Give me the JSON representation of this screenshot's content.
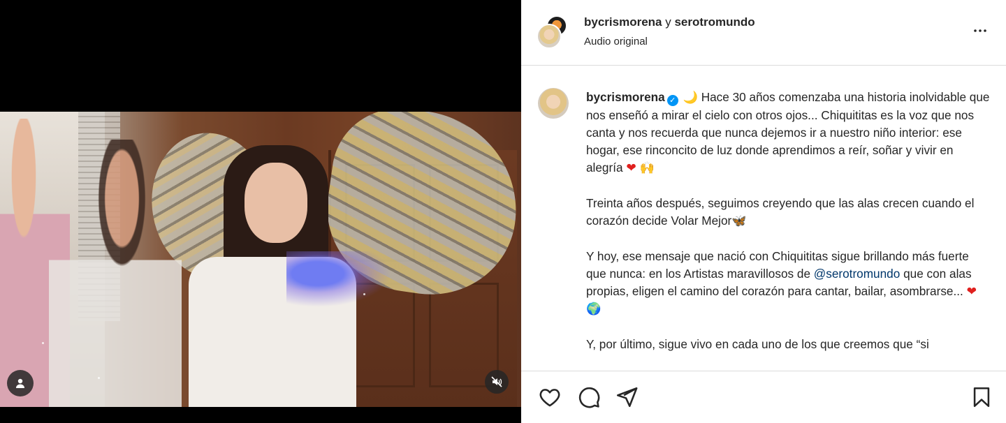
{
  "header": {
    "user1": "bycrismorena",
    "separator": "y",
    "user2": "serotromundo",
    "audio": "Audio original"
  },
  "caption": {
    "username": "bycrismorena",
    "moon_emoji": "🌙",
    "p1": "Hace 30 años comenzaba una historia inolvidable que nos enseñó a mirar el cielo con otros ojos... Chiquititas es la voz que nos canta y nos recuerda que nunca dejemos ir a nuestro niño interior: ese hogar, ese rinconcito de luz donde aprendimos a reír, soñar y vivir en alegría",
    "p1_emojis": "🙌",
    "heart": "❤",
    "p2": "Treinta años después, seguimos creyendo que las alas crecen cuando el corazón decide Volar Mejor",
    "butterfly_emoji": "🦋",
    "p3_a": "Y hoy, ese mensaje que nació con Chiquititas sigue brillando más fuerte que nunca: en los Artistas maravillosos de",
    "mention": "@serotromundo",
    "p3_b": "que con alas propias, eligen el camino del corazón para cantar, bailar, asombrarse...",
    "p3_emoji2": "🌍",
    "p4": "Y, por último, sigue vivo en cada uno de los que creemos que “si"
  },
  "icons": {
    "like": "heart-outline-icon",
    "comment": "comment-bubble-icon",
    "share": "paper-plane-icon",
    "save": "bookmark-icon",
    "more": "more-options-icon",
    "user_tag": "user-tag-icon",
    "mute": "speaker-muted-icon"
  },
  "colors": {
    "text": "#262626",
    "verified": "#0095f6",
    "mention": "#00376b",
    "heart": "#e0201e"
  }
}
